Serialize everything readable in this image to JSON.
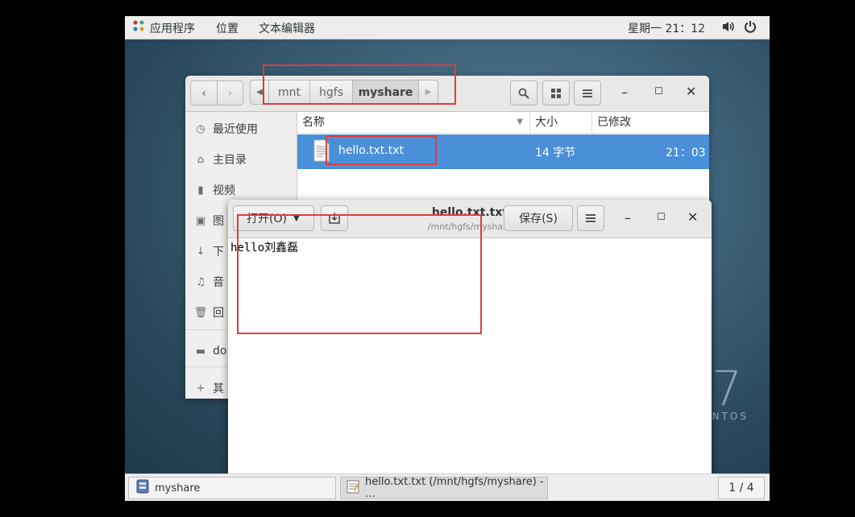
{
  "topbar": {
    "menu_applications": "应用程序",
    "menu_places": "位置",
    "menu_text_editor": "文本编辑器",
    "clock": "星期一 21：12"
  },
  "desktop": {
    "watermark_number": "7",
    "watermark_text": "ENTOS"
  },
  "nautilus": {
    "breadcrumbs": [
      "mnt",
      "hgfs",
      "myshare"
    ],
    "sidebar": [
      {
        "label": "最近使用",
        "icon": "clock-icon"
      },
      {
        "label": "主目录",
        "icon": "home-icon"
      },
      {
        "label": "视频",
        "icon": "video-icon"
      },
      {
        "label": "图",
        "icon": "camera-icon"
      },
      {
        "label": "下",
        "icon": "download-icon"
      },
      {
        "label": "音",
        "icon": "music-icon"
      },
      {
        "label": "回",
        "icon": "trash-icon"
      },
      {
        "label": "do",
        "icon": "folder-icon"
      },
      {
        "label": "其",
        "icon": "plus-icon"
      }
    ],
    "columns": {
      "name": "名称",
      "size": "大小",
      "modified": "已修改"
    },
    "files": [
      {
        "name": "hello.txt.txt",
        "size": "14 字节",
        "modified": "21：03"
      }
    ]
  },
  "gedit": {
    "open_label": "打开(O)",
    "title": "hello.txt.txt",
    "subtitle": "/mnt/hgfs/myshare",
    "save_label": "保存(S)",
    "content": "hello刘鑫磊"
  },
  "taskbar": {
    "items": [
      {
        "label": "myshare"
      },
      {
        "label": "hello.txt.txt (/mnt/hgfs/myshare) - …"
      }
    ],
    "workspace": "1 / 4"
  },
  "colors": {
    "selection": "#4a90d9",
    "annotation_red": "#e03c3c"
  }
}
